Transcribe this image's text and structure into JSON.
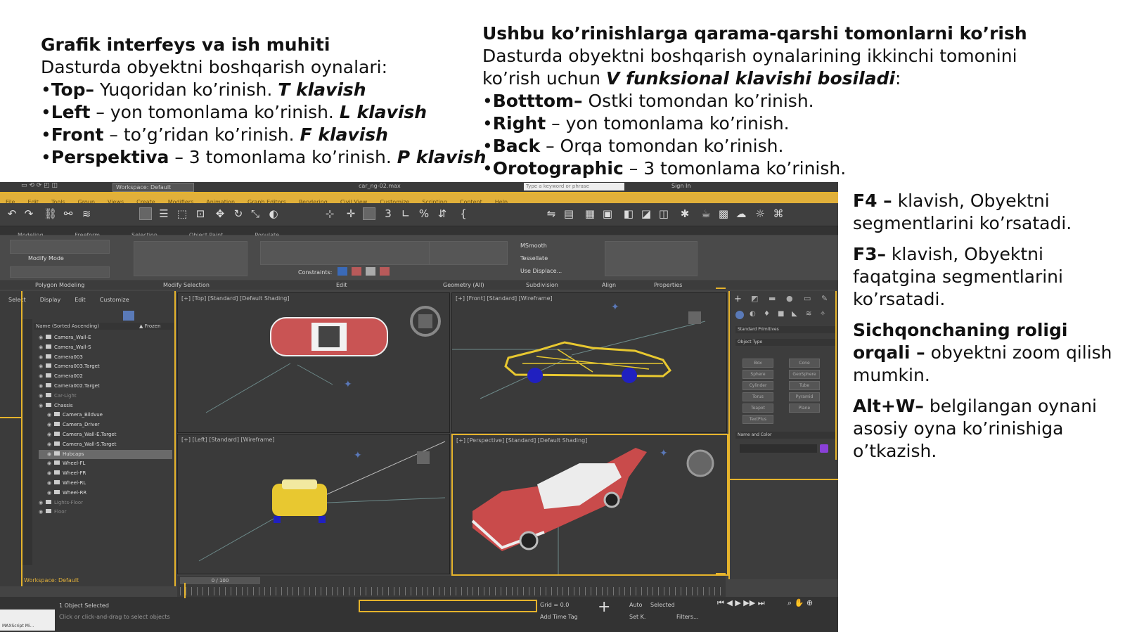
{
  "left": {
    "title": "Grafik interfeys va ish muhiti",
    "intro": "Dasturda obyektni boshqarish oynalari:",
    "items": [
      {
        "term": "Top–",
        "desc": " Yuqoridan ko’rinish. ",
        "key": "T klavish"
      },
      {
        "term": "Left",
        "desc": " – yon tomonlama ko’rinish. ",
        "key": "L klavish"
      },
      {
        "term": "Front",
        "desc": " – to’g’ridan ko’rinish. ",
        "key": "F klavish"
      },
      {
        "term": "Perspektiva",
        "desc": " – 3 tomonlama ko’rinish. ",
        "key": "P klavish"
      }
    ]
  },
  "middle": {
    "title": "Ushbu ko’rinishlarga qarama-qarshi tomonlarni ko’rish",
    "intro_1": "Dasturda obyektni boshqarish oynalarining ikkinchi tomonini",
    "intro_2a": "ko’rish uchun ",
    "intro_2b": "V funksional klavishi bosiladi",
    "intro_2c": ":",
    "items": [
      {
        "term": "Botttom–",
        "desc": " Ostki tomondan ko’rinish."
      },
      {
        "term": "Right",
        "desc": " – yon tomonlama ko’rinish."
      },
      {
        "term": "Back",
        "desc": " – Orqa tomondan ko’rinish."
      },
      {
        "term": "Orotographic",
        "desc": " – 3 tomonlama ko’rinish."
      }
    ]
  },
  "right": {
    "items": [
      {
        "term": "F4 –",
        "desc": " klavish, Obyektni segmentlarini ko’rsatadi."
      },
      {
        "term": "F3–",
        "desc": " klavish, Obyektni faqatgina segmentlarini ko’rsatadi."
      },
      {
        "term": "Sichqonchaning roligi orqali –",
        "desc": " obyektni zoom qilish mumkin."
      },
      {
        "term": "Alt+W–",
        "desc": " belgilangan oynani asosiy oyna ko’rinishiga o’tkazish."
      }
    ]
  },
  "screenshot": {
    "workspace": "Workspace: Default",
    "file_name": "car_ng-02.max",
    "search_placeholder": "Type a keyword or phrase",
    "sign_in": "Sign In",
    "menu": [
      "File",
      "Edit",
      "Tools",
      "Group",
      "Views",
      "Create",
      "Modifiers",
      "Animation",
      "Graph Editors",
      "Rendering",
      "Civil View",
      "Customize",
      "Scripting",
      "Content",
      "Help"
    ],
    "ribbon_tabs": [
      "Modeling",
      "Freeform",
      "Selection",
      "Object Paint",
      "Populate"
    ],
    "ribbon_labels": [
      "Polygon Modeling",
      "Modify Selection",
      "Edit",
      "Geometry (All)",
      "Subdivision",
      "Align",
      "Properties"
    ],
    "ribbon_items": {
      "msmooth": "MSmooth",
      "tessellate": "Tessellate",
      "use_displace": "Use Displace...",
      "constraints": "Constraints:",
      "modify_mode": "Modify Mode"
    },
    "explorer_tabs": [
      "Select",
      "Display",
      "Edit",
      "Customize"
    ],
    "explorer_header": "Name (Sorted Ascending)",
    "explorer_frozen": "▲ Frozen",
    "scene_items": [
      "Camera_Wall-E",
      "Camera_Wall-S",
      "Camera003",
      "Camera003.Target",
      "Camera002",
      "Camera002.Target",
      "Car-Light",
      "Chassis",
      "Camera_Bildvue",
      "Camera_Driver",
      "Camera_Wall-E.Target",
      "Camera_Wall-S.Target",
      "Hubcaps",
      "Wheel-FL",
      "Wheel-FR",
      "Wheel-RL",
      "Wheel-RR",
      "Lights-Floor",
      "Floor"
    ],
    "viewports": {
      "top": "[+] [Top] [Standard] [Default Shading]",
      "front": "[+] [Front] [Standard] [Wireframe]",
      "left": "[+] [Left] [Standard] [Wireframe]",
      "perspective": "[+] [Perspective] [Standard] [Default Shading]"
    },
    "command_panel": {
      "dropdown": "Standard Primitives",
      "object_type": "Object Type",
      "buttons": [
        "Box",
        "Cone",
        "Sphere",
        "GeoSphere",
        "Cylinder",
        "Tube",
        "Torus",
        "Pyramid",
        "Teapot",
        "Plane",
        "TextPlus"
      ],
      "name_color": "Name and Color"
    },
    "timeline_counter": "0 / 100",
    "status": {
      "workspace_footer": "Workspace: Default",
      "selected": "1 Object Selected",
      "hint": "Click or click-and-drag to select objects",
      "grid": "Grid = 0.0",
      "add_time_tag": "Add Time Tag",
      "auto": "Auto",
      "selected_mode": "Selected",
      "set_key": "Set K.",
      "filters": "Filters...",
      "maxscript": "MAXScript Mi..."
    },
    "colors": {
      "accent": "#e6b42c",
      "car_red": "#c94b4b",
      "car_yellow": "#e8c830",
      "wheel_blue": "#2020c0"
    }
  }
}
